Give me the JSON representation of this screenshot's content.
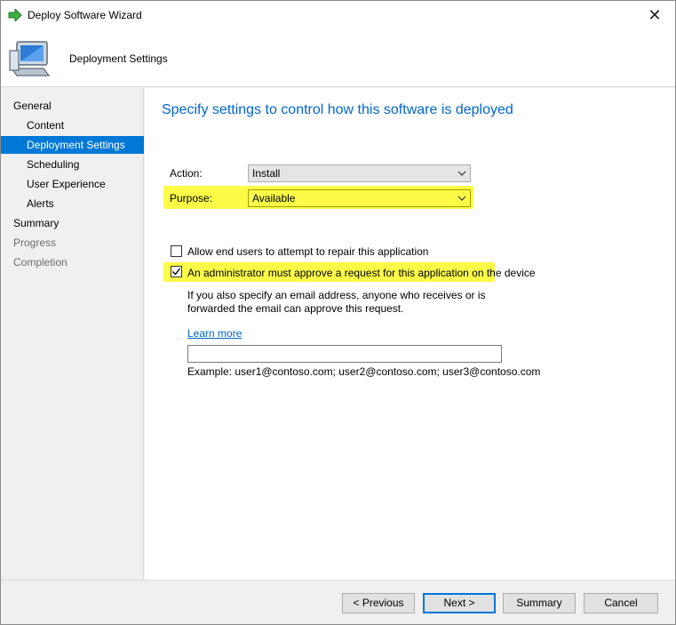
{
  "window": {
    "title": "Deploy Software Wizard",
    "close_glyph": "✕"
  },
  "header": {
    "title": "Deployment Settings"
  },
  "nav": {
    "items": [
      {
        "label": "General"
      },
      {
        "label": "Content"
      },
      {
        "label": "Deployment Settings"
      },
      {
        "label": "Scheduling"
      },
      {
        "label": "User Experience"
      },
      {
        "label": "Alerts"
      },
      {
        "label": "Summary"
      },
      {
        "label": "Progress"
      },
      {
        "label": "Completion"
      }
    ]
  },
  "main": {
    "heading": "Specify settings to control how this software is deployed",
    "action": {
      "label": "Action:",
      "value": "Install"
    },
    "purpose": {
      "label": "Purpose:",
      "value": "Available"
    },
    "repair_checkbox": {
      "label": "Allow end users to attempt to repair this application",
      "checked": false
    },
    "approve_checkbox": {
      "label": "An administrator must approve a request for this application on the device",
      "checked": true
    },
    "info_text": "If you also specify an email address, anyone who receives or is forwarded the email can approve this request.",
    "learn_more": "Learn more",
    "email": {
      "value": "",
      "example": "Example: user1@contoso.com; user2@contoso.com; user3@contoso.com"
    }
  },
  "footer": {
    "previous": "< Previous",
    "next": "Next >",
    "summary": "Summary",
    "cancel": "Cancel"
  },
  "colors": {
    "accent": "#0078d7",
    "heading": "#0066cc",
    "highlight": "#fcfc48"
  }
}
